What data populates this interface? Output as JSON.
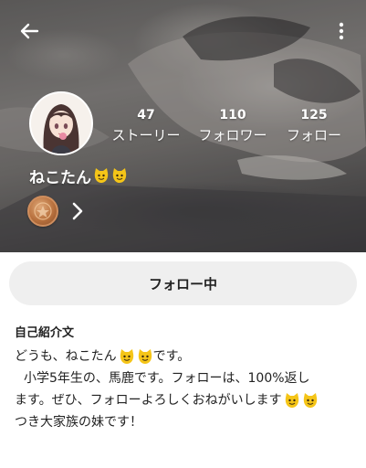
{
  "header": {
    "back_icon": "arrow-left-icon",
    "menu_icon": "more-vertical-icon"
  },
  "profile": {
    "avatar_icon": "anime-girl-avatar",
    "name": "ねこたん",
    "name_emoji": [
      "cat-face-emoji",
      "cat-face-emoji"
    ],
    "badge_icon": "bronze-coin-badge",
    "badge_arrow_icon": "chevron-right-icon"
  },
  "stats": {
    "stories": {
      "value": "47",
      "label": "ストーリー"
    },
    "followers": {
      "value": "110",
      "label": "フォロワー"
    },
    "following": {
      "value": "125",
      "label": "フォロー"
    }
  },
  "actions": {
    "follow_label": "フォロー中"
  },
  "bio": {
    "title": "自己紹介文",
    "lines": [
      {
        "text_before": "どうも、ねこたん",
        "emoji_count": 2,
        "text_after": "です。"
      },
      {
        "text_before": "小学5年生の、馬鹿です。フォローは、100%返し",
        "emoji_count": 0,
        "text_after": ""
      },
      {
        "text_before": "ます。ぜひ、フォローよろしくおねがいします",
        "emoji_count": 2,
        "text_after": ""
      },
      {
        "text_before": "つき大家族の妹です！",
        "emoji_count": 0,
        "text_after": ""
      }
    ]
  },
  "colors": {
    "hero_tint": "#6d6b6a",
    "follow_button_bg": "#efefef",
    "emoji_yellow": "#f5c518"
  }
}
